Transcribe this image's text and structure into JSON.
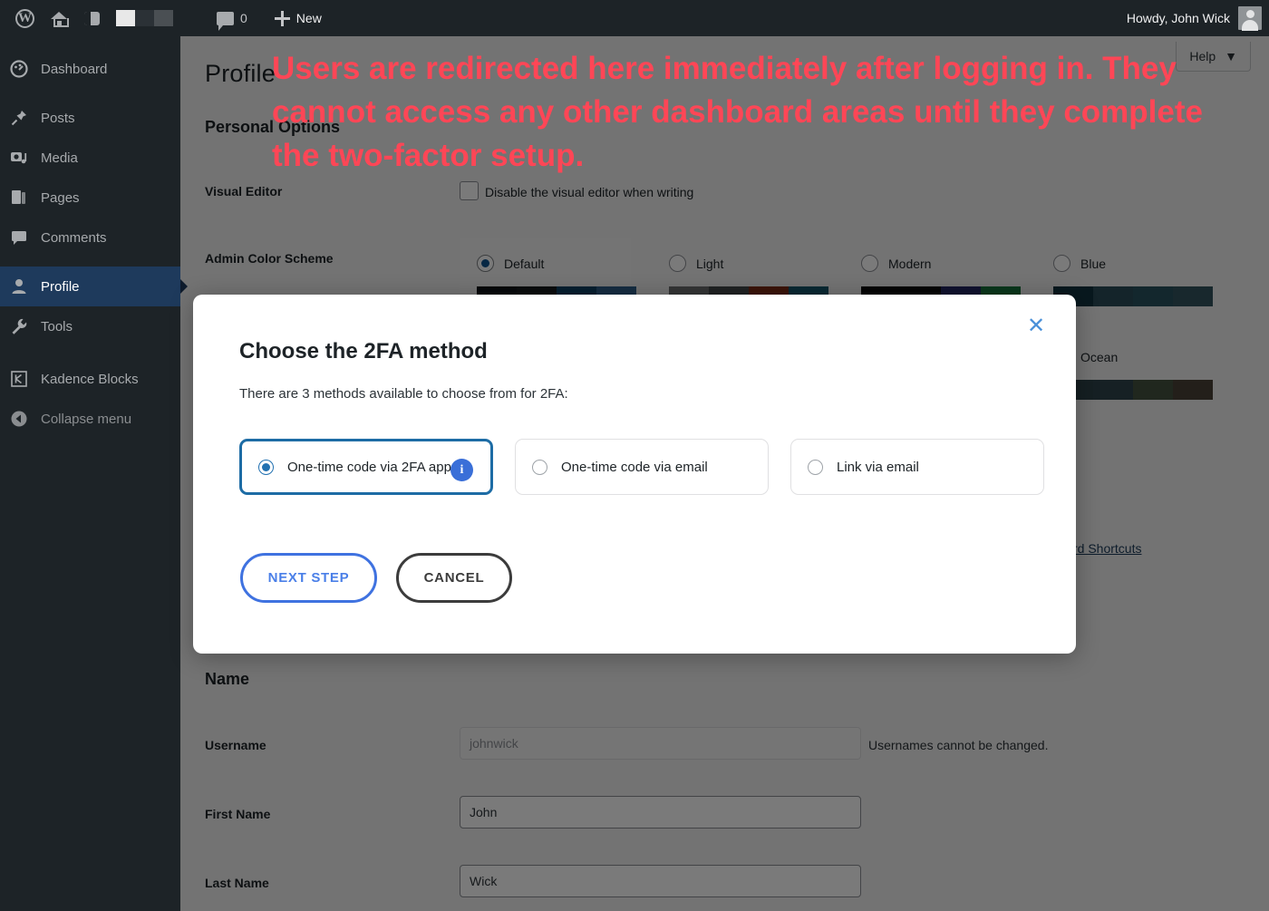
{
  "adminbar": {
    "logo_icon": "wordpress-logo-icon",
    "site_icon": "home-icon",
    "customize_icon": "half-circle-icon",
    "swatch_icon": "color-swatch-icon",
    "comments_icon": "comment-bubble-icon",
    "comments_count": "0",
    "new_icon": "plus-icon",
    "new_label": "New",
    "howdy": "Howdy, John Wick",
    "avatar_icon": "user-avatar-icon"
  },
  "sidebar": {
    "items": [
      {
        "label": "Dashboard",
        "icon": "dashboard-gauge-icon",
        "active": false
      },
      {
        "label": "Posts",
        "icon": "pin-icon",
        "active": false
      },
      {
        "label": "Media",
        "icon": "media-camera-icon",
        "active": false
      },
      {
        "label": "Pages",
        "icon": "pages-icon",
        "active": false
      },
      {
        "label": "Comments",
        "icon": "comment-bubble-icon",
        "active": false
      },
      {
        "label": "Profile",
        "icon": "user-icon",
        "active": true
      },
      {
        "label": "Tools",
        "icon": "wrench-icon",
        "active": false
      },
      {
        "label": "Kadence Blocks",
        "icon": "kadence-blocks-icon",
        "active": false
      },
      {
        "label": "Collapse menu",
        "icon": "collapse-arrow-icon",
        "active": false
      }
    ]
  },
  "page": {
    "help_label": "Help",
    "help_caret": "▼",
    "title": "Profile",
    "personal_options_heading": "Personal Options",
    "visual_editor_label": "Visual Editor",
    "visual_editor_checkbox_text": "Disable the visual editor when writing",
    "admin_color_scheme_label": "Admin Color Scheme",
    "keyboard_shortcuts_link": "rd Shortcuts",
    "name_heading": "Name",
    "username_label": "Username",
    "username_value": "johnwick",
    "username_helper": "Usernames cannot be changed.",
    "first_name_label": "First Name",
    "first_name_value": "John",
    "last_name_label": "Last Name",
    "last_name_value": "Wick"
  },
  "color_schemes": [
    {
      "name": "Default",
      "selected": true,
      "swatches": [
        "#101317",
        "#16191d",
        "#0e4265",
        "#2e5f8a"
      ]
    },
    {
      "name": "Light",
      "selected": false,
      "swatches": [
        "#6d6f71",
        "#44474a",
        "#7b2a13",
        "#13566b"
      ]
    },
    {
      "name": "Modern",
      "selected": false,
      "swatches": [
        "#0b0b0c",
        "#232663",
        "#16733b",
        "#16733b"
      ]
    },
    {
      "name": "Blue",
      "selected": false,
      "swatches": [
        "#12323f",
        "#2b4d58",
        "#29525f",
        "#32545e"
      ]
    },
    {
      "name": "Ocean",
      "selected": false,
      "swatches": [
        "#2c4148",
        "#2f444c",
        "#43523f",
        "#4a4238"
      ]
    }
  ],
  "annotation": {
    "text": "Users are redirected here immediately after logging in. They cannot access any other dashboard areas until they complete the two-factor setup.",
    "color": "#ff4656"
  },
  "modal": {
    "close_icon": "close-x-icon",
    "title": "Choose the 2FA method",
    "subtitle": "There are 3 methods available to choose from for 2FA:",
    "options": [
      {
        "label": "One-time code via 2FA app",
        "selected": true,
        "info_badge": "i"
      },
      {
        "label": "One-time code via email",
        "selected": false,
        "info_badge": ""
      },
      {
        "label": "Link via email",
        "selected": false,
        "info_badge": ""
      }
    ],
    "next_label": "NEXT STEP",
    "cancel_label": "CANCEL",
    "accent_color": "#3f72e0"
  }
}
